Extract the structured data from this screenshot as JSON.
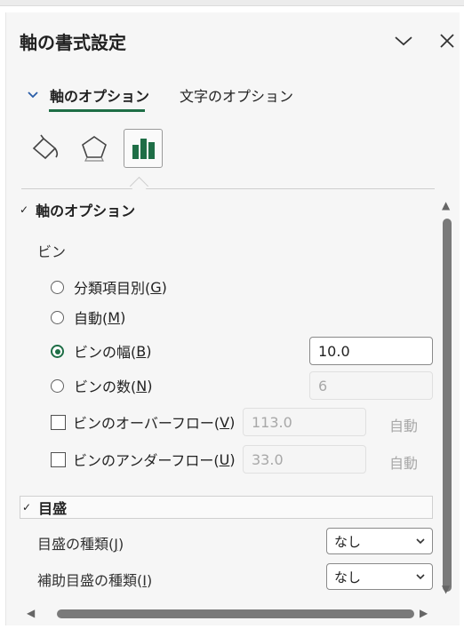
{
  "pane": {
    "title": "軸の書式設定",
    "dropdown_icon": "chevron-down-icon",
    "close_icon": "close-icon"
  },
  "tabs": [
    {
      "label": "軸のオプション",
      "active": true
    },
    {
      "label": "文字のオプション",
      "active": false
    }
  ],
  "icon_tabs": [
    {
      "name": "fill-line-icon",
      "selected": false
    },
    {
      "name": "effects-pentagon-icon",
      "selected": false
    },
    {
      "name": "axis-options-bar-chart-icon",
      "selected": true
    }
  ],
  "axis_options": {
    "header": "軸のオプション",
    "bins_label": "ビン",
    "radios": [
      {
        "prefix": "分類項目別(",
        "key": "G",
        "suffix": ")",
        "checked": false
      },
      {
        "prefix": "自動(",
        "key": "M",
        "suffix": ")",
        "checked": false
      },
      {
        "prefix": "ビンの幅(",
        "key": "B",
        "suffix": ")",
        "checked": true
      },
      {
        "prefix": "ビンの数(",
        "key": "N",
        "suffix": ")",
        "checked": false
      }
    ],
    "bin_width_value": "10.0",
    "bin_count_value": "6",
    "overflow": {
      "prefix": "ビンのオーバーフロー(",
      "key": "V",
      "suffix": ")",
      "value": "113.0",
      "auto": "自動",
      "checked": false
    },
    "underflow": {
      "prefix": "ビンのアンダーフロー(",
      "key": "U",
      "suffix": ")",
      "value": "33.0",
      "auto": "自動",
      "checked": false
    }
  },
  "tick_marks": {
    "header": "目盛",
    "major": {
      "prefix": "目盛の種類(",
      "key": "J",
      "suffix": ")",
      "value": "なし"
    },
    "minor": {
      "prefix": "補助目盛の種類(",
      "key": "I",
      "suffix": ")",
      "value": "なし"
    }
  },
  "colors": {
    "accent": "#1e6e46"
  }
}
